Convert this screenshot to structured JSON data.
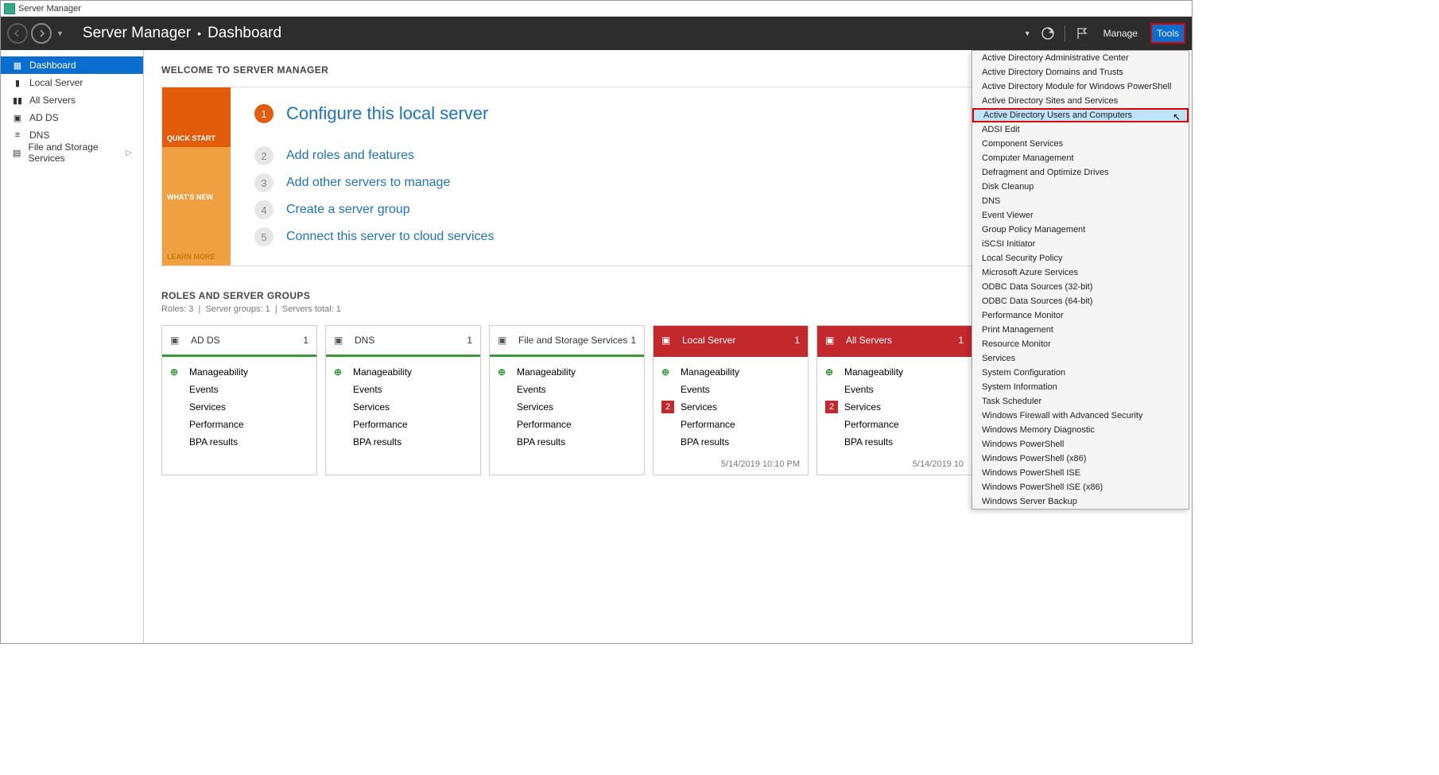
{
  "titlebar": {
    "label": "Server Manager"
  },
  "breadcrumb": {
    "app": "Server Manager",
    "page": "Dashboard"
  },
  "toolbar": {
    "manage": "Manage",
    "tools": "Tools"
  },
  "sidebar": {
    "items": [
      {
        "label": "Dashboard",
        "active": true
      },
      {
        "label": "Local Server"
      },
      {
        "label": "All Servers"
      },
      {
        "label": "AD DS"
      },
      {
        "label": "DNS"
      },
      {
        "label": "File and Storage Services",
        "has_sub": true
      }
    ]
  },
  "welcome": {
    "title": "WELCOME TO SERVER MANAGER",
    "tabs": {
      "quick_start": "QUICK START",
      "whats_new": "WHAT'S NEW",
      "learn_more": "LEARN MORE"
    },
    "steps": [
      {
        "n": "1",
        "label": "Configure this local server",
        "primary": true
      },
      {
        "n": "2",
        "label": "Add roles and features"
      },
      {
        "n": "3",
        "label": "Add other servers to manage"
      },
      {
        "n": "4",
        "label": "Create a server group"
      },
      {
        "n": "5",
        "label": "Connect this server to cloud services"
      }
    ]
  },
  "groups": {
    "title": "ROLES AND SERVER GROUPS",
    "sub_roles": "Roles: 3",
    "sub_groups": "Server groups: 1",
    "sub_total": "Servers total: 1",
    "rows": {
      "manageability": "Manageability",
      "events": "Events",
      "services": "Services",
      "performance": "Performance",
      "bpa": "BPA results"
    },
    "tiles": [
      {
        "name": "AD DS",
        "count": "1",
        "status": "green",
        "services_alert": null,
        "ts": ""
      },
      {
        "name": "DNS",
        "count": "1",
        "status": "green",
        "services_alert": null,
        "ts": ""
      },
      {
        "name": "File and Storage Services",
        "count": "1",
        "status": "green",
        "services_alert": null,
        "ts": ""
      },
      {
        "name": "Local Server",
        "count": "1",
        "status": "red",
        "services_alert": "2",
        "ts": "5/14/2019 10:10 PM"
      },
      {
        "name": "All Servers",
        "count": "1",
        "status": "red",
        "services_alert": "2",
        "ts": "5/14/2019 10"
      }
    ]
  },
  "menu": {
    "items": [
      "Active Directory Administrative Center",
      "Active Directory Domains and Trusts",
      "Active Directory Module for Windows PowerShell",
      "Active Directory Sites and Services",
      "Active Directory Users and Computers",
      "ADSI Edit",
      "Component Services",
      "Computer Management",
      "Defragment and Optimize Drives",
      "Disk Cleanup",
      "DNS",
      "Event Viewer",
      "Group Policy Management",
      "iSCSI Initiator",
      "Local Security Policy",
      "Microsoft Azure Services",
      "ODBC Data Sources (32-bit)",
      "ODBC Data Sources (64-bit)",
      "Performance Monitor",
      "Print Management",
      "Resource Monitor",
      "Services",
      "System Configuration",
      "System Information",
      "Task Scheduler",
      "Windows Firewall with Advanced Security",
      "Windows Memory Diagnostic",
      "Windows PowerShell",
      "Windows PowerShell (x86)",
      "Windows PowerShell ISE",
      "Windows PowerShell ISE (x86)",
      "Windows Server Backup"
    ],
    "highlighted_index": 4
  }
}
